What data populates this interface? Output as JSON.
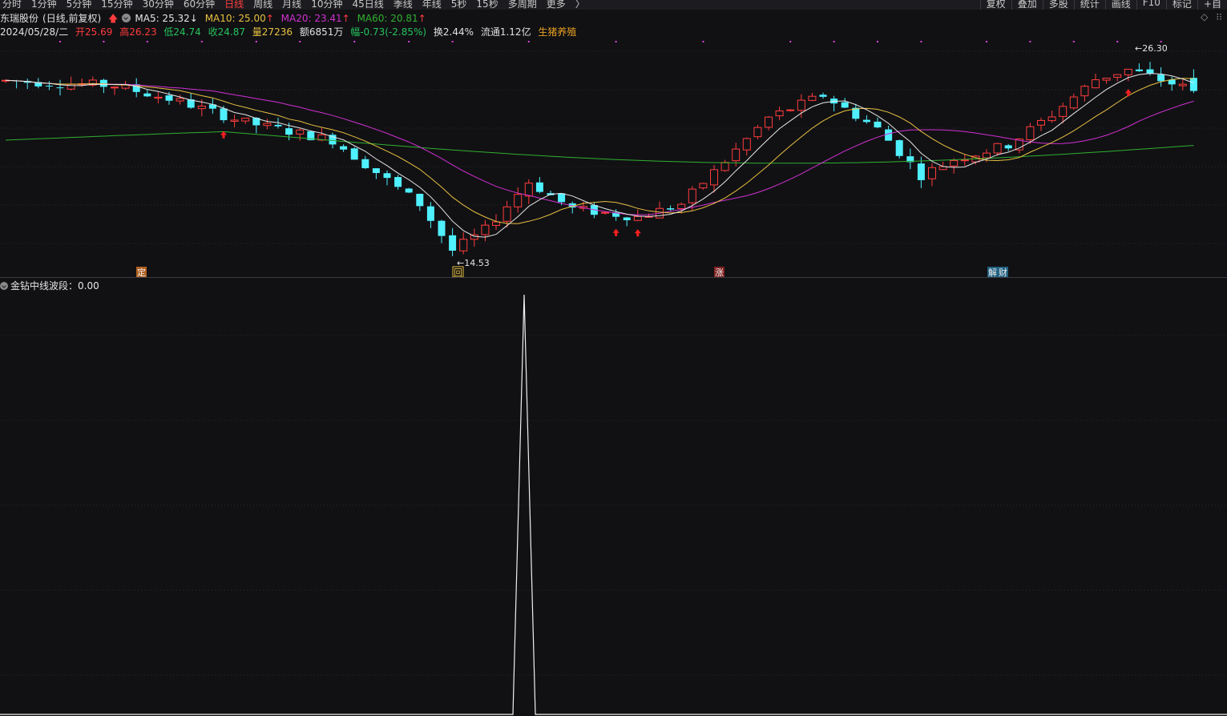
{
  "toolbar": {
    "tabs": [
      "分时",
      "1分钟",
      "5分钟",
      "15分钟",
      "30分钟",
      "60分钟",
      "日线",
      "周线",
      "月线",
      "10分钟",
      "45日线",
      "季线",
      "年线",
      "5秒",
      "15秒",
      "多周期",
      "更多"
    ],
    "active_tab": "日线",
    "more_suffix": "〉",
    "tools": [
      "复权",
      "叠加",
      "多股",
      "统计",
      "画线",
      "F10",
      "标记",
      "+自"
    ]
  },
  "header": {
    "stock_name": "东瑞股份",
    "period_note": "(日线,前复权)",
    "ma5": "MA5: 25.32",
    "ma5_arrow": "↓",
    "ma10": "MA10: 25.00",
    "ma10_arrow": "↑",
    "ma20": "MA20: 23.41",
    "ma20_arrow": "↑",
    "ma60": "MA60: 20.81",
    "ma60_arrow": "↑"
  },
  "quote": {
    "date": "2024/05/28/二",
    "open": "开25.69",
    "high": "高26.23",
    "low": "低24.74",
    "close": "收24.87",
    "volume": "量27236",
    "amount": "额6851万",
    "change": "幅-0.73(-2.85%)",
    "turnover": "换2.44%",
    "float_cap": "流通1.12亿",
    "concept": "生猪养殖"
  },
  "chart_data": {
    "type": "candlestick",
    "price_axis": [
      14.0,
      27.5
    ],
    "last_bar": {
      "open": 25.69,
      "high": 26.23,
      "low": 24.74,
      "close": 24.87
    },
    "high_label": "26.30",
    "low_label": "14.53",
    "markers": [
      "定",
      "回",
      "涨",
      "解",
      "财"
    ],
    "colors": {
      "up": "#ff3c3c",
      "down": "#4ff0ff",
      "ma5": "#e6e6e6",
      "ma10": "#e8c040",
      "ma20": "#d030d0",
      "ma60": "#30b030"
    }
  },
  "indicator": {
    "name": "金钻中线波段",
    "value": "0.00"
  },
  "icons": {
    "settings": "gear-icon",
    "diamond": "diamond-icon",
    "dots": "dots-icon"
  }
}
